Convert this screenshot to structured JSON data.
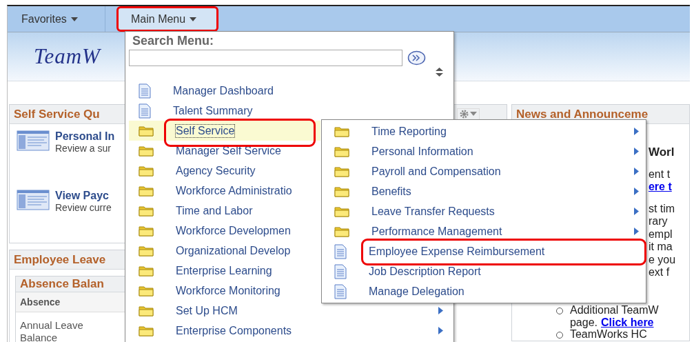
{
  "nav": {
    "tabs": [
      {
        "label": "Favorites",
        "selected": false,
        "highlighted": false
      },
      {
        "label": "Main Menu",
        "selected": true,
        "highlighted": true
      }
    ]
  },
  "banner": {
    "logo": "TeamW"
  },
  "quick_links": {
    "title": "Self Service Qu",
    "items": [
      {
        "title": "Personal In",
        "description": "Review a sur"
      },
      {
        "title": "View Payc",
        "description": "Review curre"
      }
    ]
  },
  "leave": {
    "title": "Employee Leave",
    "balances": {
      "title": "Absence Balan",
      "column": "Absence",
      "rows": [
        "Annual Leave Balance"
      ]
    }
  },
  "news": {
    "title": "News and Announceme",
    "paragraphs": [
      [
        [
          {
            "text": "Worl",
            "kind": "heading"
          }
        ]
      ],
      [
        [
          {
            "text": "ent t",
            "kind": "plain"
          }
        ],
        [
          {
            "text": "ere t",
            "kind": "link"
          }
        ]
      ],
      [
        [
          {
            "text": "st tim",
            "kind": "plain"
          }
        ],
        [
          {
            "text": "rary",
            "kind": "plain"
          }
        ],
        [
          {
            "text": "empl",
            "kind": "plain"
          }
        ],
        [
          {
            "text": "it ma",
            "kind": "plain"
          }
        ],
        [
          {
            "text": "e you",
            "kind": "plain"
          }
        ],
        [
          {
            "text": "ext f",
            "kind": "plain"
          }
        ]
      ]
    ],
    "bullets": [
      [
        [
          {
            "text": "Additional TeamW",
            "kind": "plain"
          }
        ],
        [
          {
            "text": "page.",
            "kind": "plain"
          },
          {
            "text": "Click here",
            "kind": "link"
          }
        ]
      ],
      [
        [
          {
            "text": "TeamWorks HC",
            "kind": "plain"
          }
        ]
      ]
    ]
  },
  "main_menu": {
    "search_label": "Search Menu:",
    "items": [
      {
        "label": "Manager Dashboard",
        "kind": "page",
        "selected": false,
        "arrow": false,
        "highlighted": false
      },
      {
        "label": "Talent Summary",
        "kind": "page",
        "selected": false,
        "arrow": false,
        "highlighted": false
      },
      {
        "label": "Self Service",
        "kind": "folder",
        "selected": true,
        "arrow": false,
        "highlighted": true
      },
      {
        "label": "Manager Self Service",
        "kind": "folder",
        "selected": false,
        "arrow": false,
        "highlighted": false
      },
      {
        "label": "Agency Security",
        "kind": "folder",
        "selected": false,
        "arrow": false,
        "highlighted": false
      },
      {
        "label": "Workforce Administratio",
        "kind": "folder",
        "selected": false,
        "arrow": false,
        "highlighted": false
      },
      {
        "label": "Time and Labor",
        "kind": "folder",
        "selected": false,
        "arrow": false,
        "highlighted": false
      },
      {
        "label": "Workforce Developmen",
        "kind": "folder",
        "selected": false,
        "arrow": false,
        "highlighted": false
      },
      {
        "label": "Organizational Develop",
        "kind": "folder",
        "selected": false,
        "arrow": false,
        "highlighted": false
      },
      {
        "label": "Enterprise Learning",
        "kind": "folder",
        "selected": false,
        "arrow": false,
        "highlighted": false
      },
      {
        "label": "Workforce Monitoring",
        "kind": "folder",
        "selected": false,
        "arrow": false,
        "highlighted": false
      },
      {
        "label": "Set Up HCM",
        "kind": "folder",
        "selected": false,
        "arrow": true,
        "highlighted": false
      },
      {
        "label": "Enterprise Components",
        "kind": "folder",
        "selected": false,
        "arrow": true,
        "highlighted": false
      }
    ]
  },
  "submenu": {
    "items": [
      {
        "label": "Time Reporting",
        "kind": "folder",
        "arrow": true,
        "highlighted": false
      },
      {
        "label": "Personal Information",
        "kind": "folder",
        "arrow": true,
        "highlighted": false
      },
      {
        "label": "Payroll and Compensation",
        "kind": "folder",
        "arrow": true,
        "highlighted": false
      },
      {
        "label": "Benefits",
        "kind": "folder",
        "arrow": true,
        "highlighted": false
      },
      {
        "label": "Leave Transfer Requests",
        "kind": "folder",
        "arrow": true,
        "highlighted": false
      },
      {
        "label": "Performance Management",
        "kind": "folder",
        "arrow": true,
        "highlighted": false
      },
      {
        "label": "Employee Expense Reimbursement",
        "kind": "page",
        "arrow": false,
        "highlighted": true
      },
      {
        "label": "Job Description Report",
        "kind": "page",
        "arrow": false,
        "highlighted": false
      },
      {
        "label": "Manage Delegation",
        "kind": "page",
        "arrow": false,
        "highlighted": false
      }
    ]
  }
}
